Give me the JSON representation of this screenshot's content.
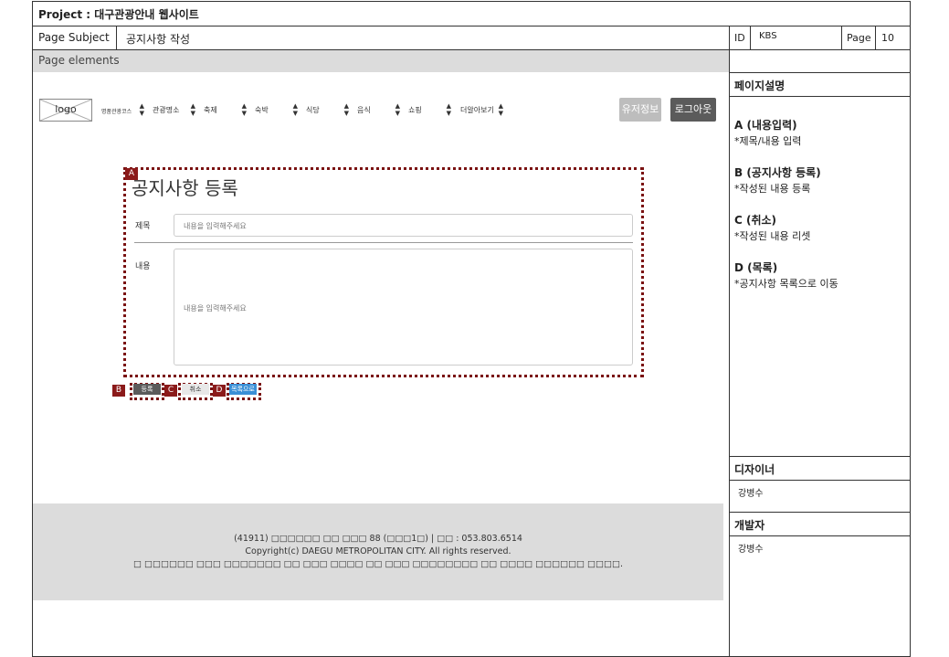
{
  "header": {
    "project": "Project : 대구관광안내 웹사이트",
    "page_subject_label": "Page Subject",
    "page_subject": "공지사항 작성",
    "id_label": "ID",
    "id_value": "KBS",
    "page_label": "Page",
    "page_value": "10",
    "page_elements": "Page elements"
  },
  "nav": {
    "logo": "logo",
    "menus": [
      "명품관광코스",
      "관광명소",
      "축제",
      "숙박",
      "식당",
      "음식",
      "쇼핑",
      "더알아보기"
    ],
    "user_button": "유저정보",
    "logout_button": "로그아웃"
  },
  "form": {
    "title": "공지사항 등록",
    "subject_label": "제목",
    "subject_placeholder": "내용을 입력해주세요",
    "content_label": "내용",
    "content_placeholder": "내용을 입력해주세요",
    "buttons": {
      "register": "등록",
      "cancel": "취소",
      "list": "목록으로"
    },
    "tags": {
      "a": "A",
      "b": "B",
      "c": "C",
      "d": "D"
    }
  },
  "footer": {
    "line1": "(41911) □□□□□□ □□ □□□ 88 (□□□1□) | □□ : 053.803.6514",
    "line2": "Copyright(c) DAEGU METROPOLITAN CITY. All rights reserved.",
    "line3": "□ □□□□□□ □□□ □□□□□□□ □□ □□□ □□□□ □□ □□□ □□□□□□□□ □□ □□□□ □□□□□□ □□□□."
  },
  "panel": {
    "desc_title": "페이지설명",
    "items": [
      {
        "title": "A (내용입력)",
        "text": "*제목/내용 입력"
      },
      {
        "title": "B (공지사항 등록)",
        "text": "*작성된 내용 등록"
      },
      {
        "title": "C (취소)",
        "text": "*작성된 내용 리셋"
      },
      {
        "title": "D (목록)",
        "text": "*공지사항 목록으로 이동"
      }
    ],
    "designer_title": "디자이너",
    "designer_name": "강병수",
    "developer_title": "개발자",
    "developer_name": "강병수"
  },
  "colors": {
    "tag_red": "#8b1a1a",
    "dotted_border": "#7a1212",
    "list_button_blue": "#3a8fd6",
    "register_button": "#5b5b5b"
  }
}
